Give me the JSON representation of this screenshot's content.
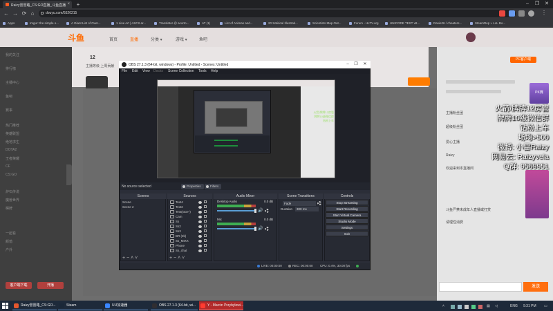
{
  "browser": {
    "tab_title": "Raizy雷雷路_CS:GO直播_斗鱼直播",
    "url": "douyu.com/5520215",
    "bookmarks": [
      "Apps",
      "Imgur: the simple o...",
      "A Giant List of Over...",
      "1 Line Art | ASCII ar...",
      "Translator @ acorto...",
      "AT (1)",
      "List of Animas and...",
      "20 Satirical Illustrati...",
      "Scientists Map Out...",
      "Forum - HLTV.org",
      "UNICODE TEST v8...",
      "Davie26 / cheaters...",
      "SteamRep » LoL Bo..."
    ],
    "window_controls": [
      "–",
      "❐",
      "✕"
    ]
  },
  "site": {
    "logo": "斗鱼",
    "nav": [
      "首页",
      "直播",
      "分类 ▾",
      "游戏 ▾",
      "鱼吧"
    ],
    "rail_items": [
      "我的关注",
      "排行榜",
      "主播中心",
      "鱼吧",
      "赛事",
      "热门推荐",
      "英雄联盟",
      "绝地求生",
      "DOTA2",
      "王者荣耀",
      "CF",
      "CS:GO",
      "炉石传说",
      "魔兽世界",
      "棋牌",
      "一起看",
      "颜值",
      "户外"
    ],
    "rail_buttons": [
      "客户端下载",
      "开播"
    ],
    "room_stats": "12",
    "room_stats_label": "主播等级  上周贡献",
    "pc_badge": "PC客户端"
  },
  "chat": {
    "lines": [
      "主播粉丝团",
      "超级粉丝团",
      "爱心主播",
      "Raizy",
      "欢迎来到本直播间",
      "斗鱼严禁未成年人直播或打赏",
      "请理性消费"
    ],
    "overlay_lines": [
      "火箭/牌牌12房管",
      "牌牌10级微信群",
      "钻粉上车",
      "场均>500",
      "微博: 小雷Raizy",
      "网易云: Raizyvela",
      "Q群: 9569951"
    ],
    "send_label": "发送",
    "banner_text": "PK赛"
  },
  "obs": {
    "title": "OBS 27.1.3 (64-bit, windows) - Profile: Untitled - Scenes: Untitled",
    "menus": [
      "File",
      "Edit",
      "View",
      "Docks",
      "Scene Collection",
      "Tools",
      "Help"
    ],
    "no_source": "No source selected",
    "properties": "Properties",
    "filters": "Filters",
    "docks": {
      "scenes": "Scenes",
      "sources": "Sources",
      "mixer": "Audio Mixer",
      "transitions": "Scene Transitions",
      "controls": "Controls"
    },
    "scenes": [
      "Scene",
      "Scene 2"
    ],
    "sources": [
      "Text4",
      "Text2",
      "Text(GDI+)",
      "Cam",
      "Ss",
      "Ss2",
      "Ss3",
      "BR (2k)",
      "Ss_MIXX",
      "Phone",
      "Ss_chat"
    ],
    "mixer": [
      {
        "name": "Desktop Audio",
        "db": "0.0 dB"
      },
      {
        "name": "Mic",
        "db": "0.0 dB"
      }
    ],
    "transition": "Fade",
    "duration_label": "Duration",
    "duration_value": "300 ms",
    "controls": [
      "Stop Streaming",
      "Start Recording",
      "Start Virtual Camera",
      "Studio Mode",
      "Settings",
      "Exit"
    ],
    "status": {
      "live": "LIVE: 00:00:00",
      "rec": "REC: 00:00:00",
      "cpu": "CPU: 0.4%, 30.00 fps"
    },
    "tool_glyphs": "+ − ˄ ˅"
  },
  "canvas_overlay": [
    "火箭/牌牌12房管",
    "牌牌10级微信群",
    "钻粉上车"
  ],
  "taskbar": {
    "apps": [
      {
        "label": "Raizy雷雷路_CS:GO...",
        "color": "#e4572e"
      },
      {
        "label": "Steam",
        "color": "#1b2838"
      },
      {
        "label": "UU加速器",
        "color": "#3a86ff"
      },
      {
        "label": "OBS 27.1.3 (64-bit, wi...",
        "color": "#302e31"
      },
      {
        "label": "Y - Marcin Przybylowi...",
        "color": "#ff3b30"
      }
    ],
    "lang": "ENG",
    "time": "9:31 PM"
  }
}
